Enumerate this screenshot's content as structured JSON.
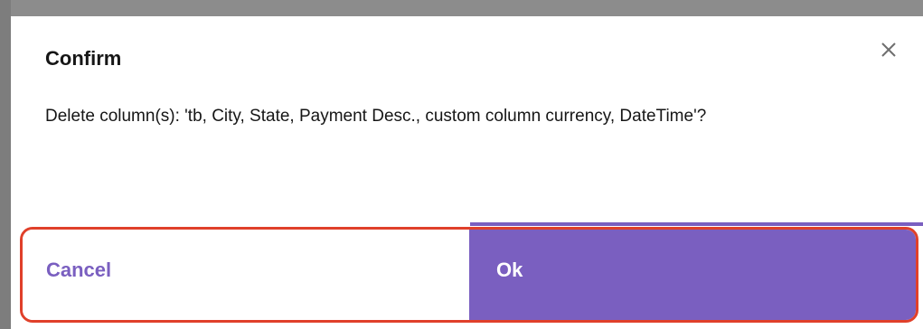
{
  "dialog": {
    "title": "Confirm",
    "message": "Delete column(s): 'tb, City, State, Payment Desc., custom column currency, DateTime'?",
    "close_icon": "close-icon",
    "cancel_label": "Cancel",
    "ok_label": "Ok"
  },
  "colors": {
    "accent": "#7a5fc0",
    "highlight_border": "#e0402a"
  }
}
